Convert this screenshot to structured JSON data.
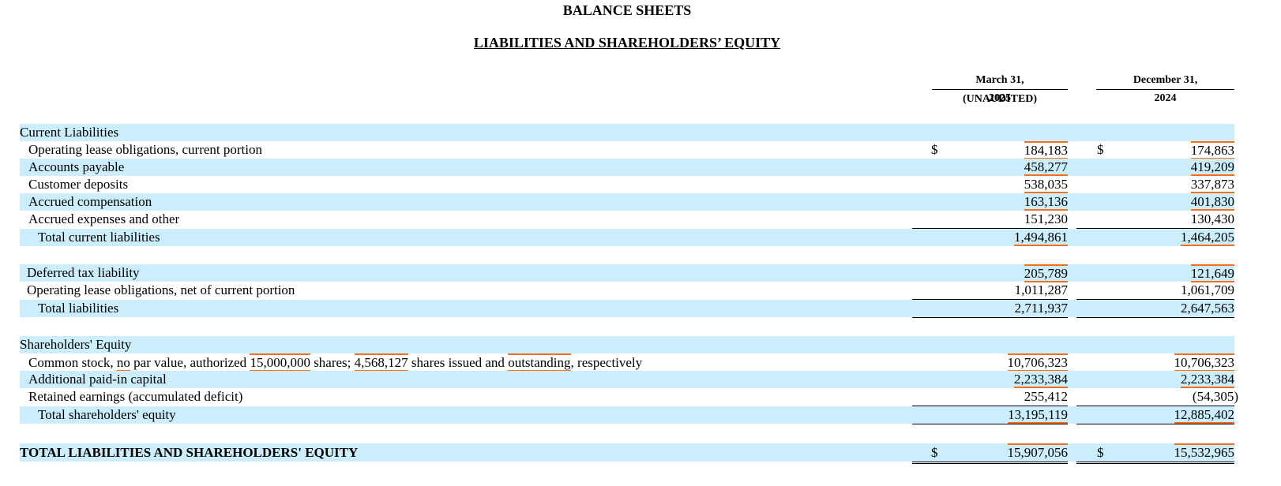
{
  "header": {
    "title": "BALANCE SHEETS",
    "subtitle": "LIABILITIES AND SHAREHOLDERS’ EQUITY"
  },
  "columns": [
    {
      "line1": "March 31,",
      "line2": "2025",
      "note": "(UNAUDITED)"
    },
    {
      "line1": "December 31,",
      "line2": "2024"
    }
  ],
  "rows": [
    {
      "label": "Current Liabilities",
      "v1": "",
      "v2": ""
    },
    {
      "label": "Operating lease obligations, current portion",
      "dollar": "$",
      "v1": "184,183",
      "v2": "174,863"
    },
    {
      "label": "Accounts payable",
      "v1": "458,277",
      "v2": "419,209"
    },
    {
      "label": "Customer deposits",
      "v1": "538,035",
      "v2": "337,873"
    },
    {
      "label": "Accrued compensation",
      "v1": "163,136",
      "v2": "401,830"
    },
    {
      "label": "Accrued expenses and other",
      "v1": "151,230",
      "v2": "130,430"
    },
    {
      "label": "Total current liabilities",
      "v1": "1,494,861",
      "v2": "1,464,205"
    },
    {
      "label": "Deferred tax liability",
      "v1": "205,789",
      "v2": "121,649"
    },
    {
      "label": "Operating lease obligations, net of current portion",
      "v1": "1,011,287",
      "v2": "1,061,709"
    },
    {
      "label": "Total liabilities",
      "v1": "2,711,937",
      "v2": "2,647,563"
    },
    {
      "label": "Shareholders' Equity",
      "v1": "",
      "v2": ""
    },
    {
      "label": "Common stock, no par value, authorized 15,000,000 shares; 4,568,127 shares issued and outstanding, respectively",
      "v1": "10,706,323",
      "v2": "10,706,323"
    },
    {
      "label": "Additional paid-in capital",
      "v1": "2,233,384",
      "v2": "2,233,384"
    },
    {
      "label": "Retained earnings (accumulated deficit)",
      "v1": "255,412",
      "v2": "(54,305)"
    },
    {
      "label": "Total shareholders' equity",
      "v1": "13,195,119",
      "v2": "12,885,402"
    },
    {
      "label": "TOTAL LIABILITIES AND SHAREHOLDERS' EQUITY",
      "dollar": "$",
      "v1": "15,907,056",
      "v2": "15,532,965"
    }
  ],
  "common_stock_parts": [
    "Common stock, ",
    "no",
    " par value, authorized ",
    "15,000,000",
    " shares; ",
    "4,568,127",
    " shares issued and ",
    "outstanding",
    ", respectively"
  ]
}
